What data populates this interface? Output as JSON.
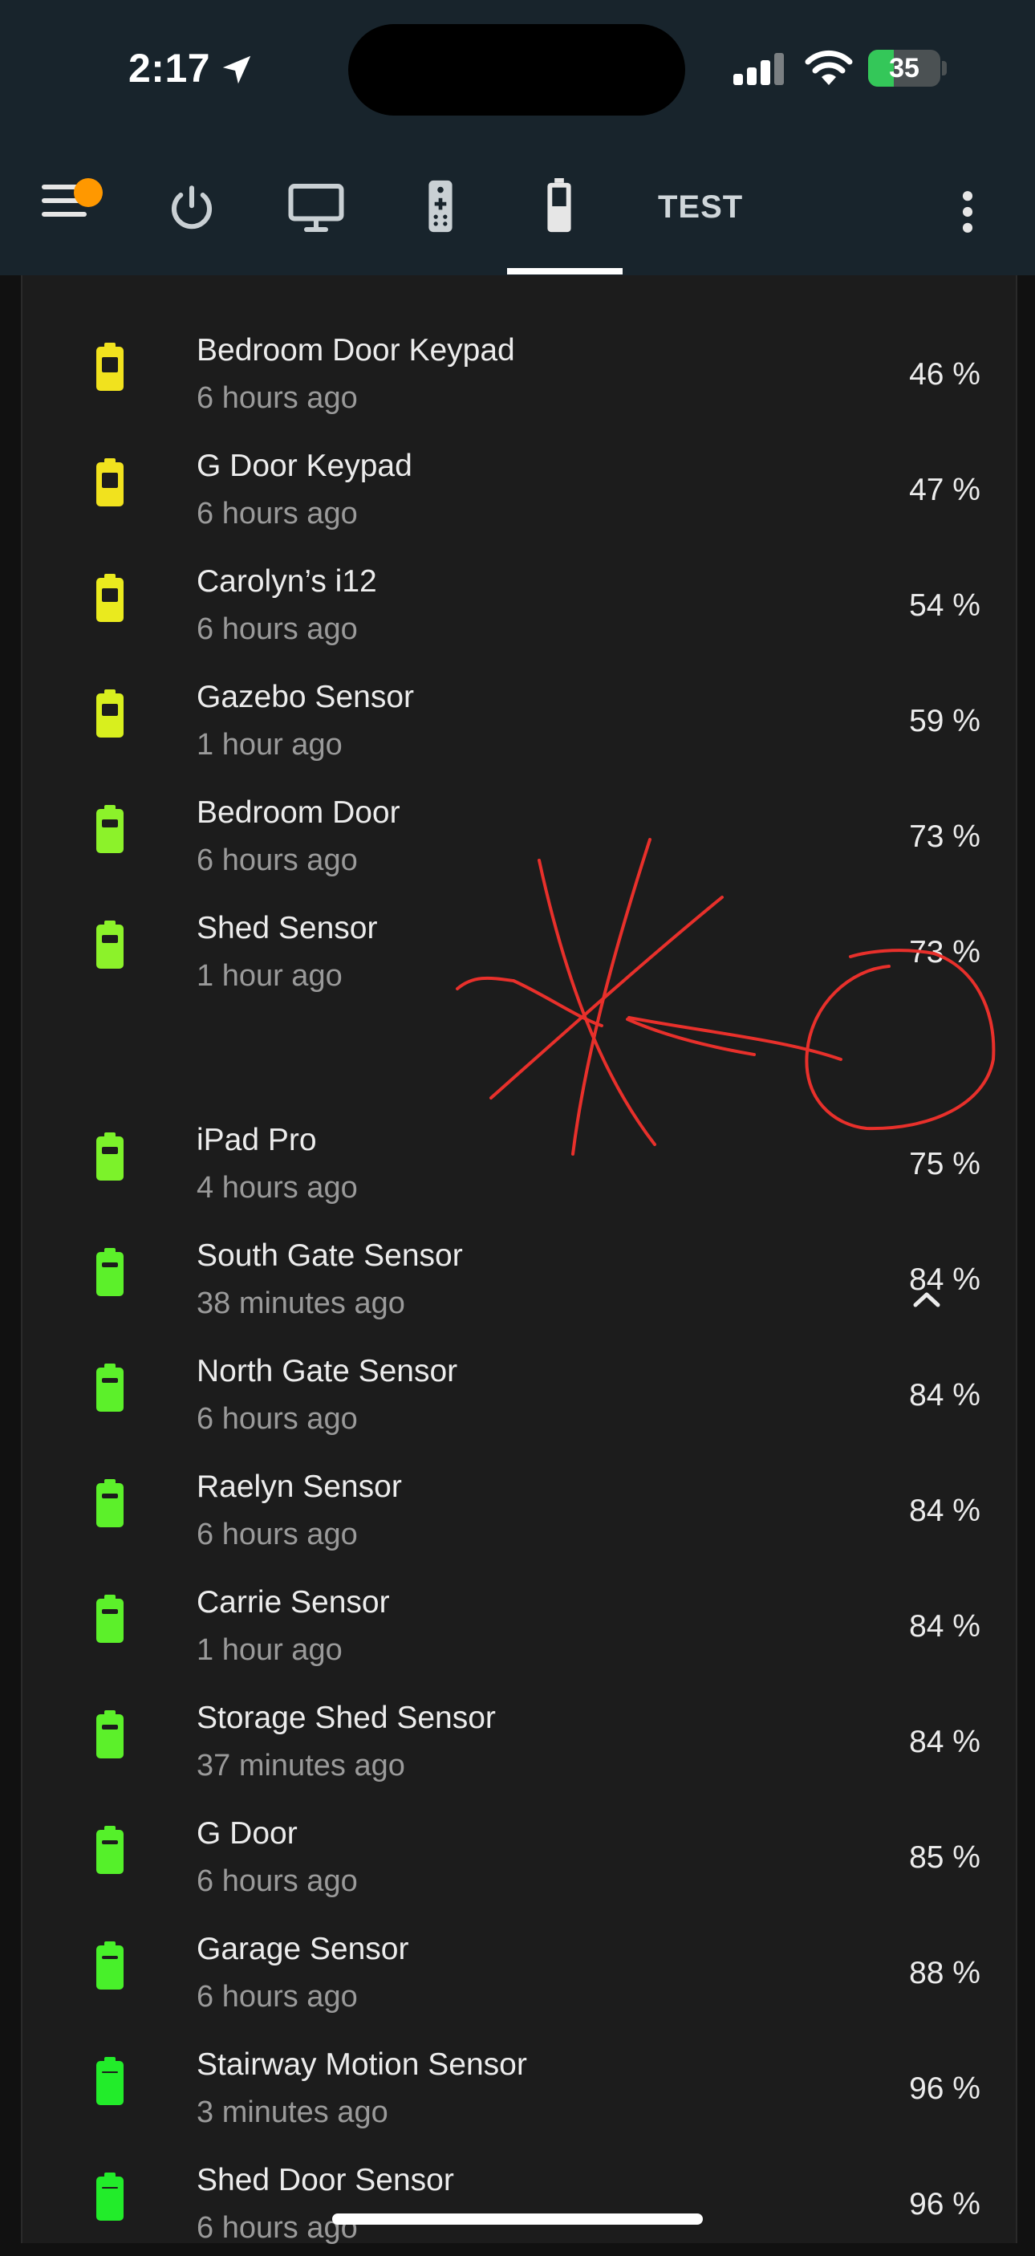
{
  "status_bar": {
    "time": "2:17",
    "battery_percent": "35",
    "battery_level": 0.35,
    "location_icon": "location-arrow-icon",
    "signal_icon": "cellular-signal-icon",
    "wifi_icon": "wifi-icon"
  },
  "toolbar": {
    "menu_icon": "hamburger-menu-icon",
    "notification_dot_color": "#ff9800",
    "tabs": [
      {
        "icon": "power-icon"
      },
      {
        "icon": "monitor-icon"
      },
      {
        "icon": "remote-control-icon"
      },
      {
        "icon": "battery-icon",
        "active": true
      },
      {
        "label": "TEST"
      }
    ],
    "overflow_icon": "more-vertical-icon"
  },
  "devices": [
    {
      "name": "Bedroom Door Keypad",
      "updated": "6 hours ago",
      "level": "46 %",
      "color": "#f1e21e"
    },
    {
      "name": "G Door Keypad",
      "updated": "6 hours ago",
      "level": "47 %",
      "color": "#f1e21e"
    },
    {
      "name": "Carolyn’s i12",
      "updated": "6 hours ago",
      "level": "54 %",
      "color": "#eaea1e"
    },
    {
      "name": "Gazebo Sensor",
      "updated": "1 hour ago",
      "level": "59 %",
      "color": "#d8ef1e"
    },
    {
      "name": "Bedroom Door",
      "updated": "6 hours ago",
      "level": "73 %",
      "color": "#8cf22a"
    },
    {
      "name": "Shed Sensor",
      "updated": "1 hour ago",
      "level": "73 %",
      "color": "#8cf22a"
    },
    {
      "name": "iPad Pro",
      "updated": "4 hours ago",
      "level": "75 %",
      "color": "#7cf22a"
    },
    {
      "name": "South Gate Sensor",
      "updated": "38 minutes ago",
      "level": "84 %",
      "color": "#5cf02a"
    },
    {
      "name": "North Gate Sensor",
      "updated": "6 hours ago",
      "level": "84 %",
      "color": "#5cf02a"
    },
    {
      "name": "Raelyn Sensor",
      "updated": "6 hours ago",
      "level": "84 %",
      "color": "#5cf02a"
    },
    {
      "name": "Carrie Sensor",
      "updated": "1 hour ago",
      "level": "84 %",
      "color": "#5cf02a"
    },
    {
      "name": "Storage Shed Sensor",
      "updated": "37 minutes ago",
      "level": "84 %",
      "color": "#5cf02a"
    },
    {
      "name": "G Door",
      "updated": "6 hours ago",
      "level": "85 %",
      "color": "#55f02a"
    },
    {
      "name": "Garage Sensor",
      "updated": "6 hours ago",
      "level": "88 %",
      "color": "#48f02a"
    },
    {
      "name": "Stairway Motion Sensor",
      "updated": "3 minutes ago",
      "level": "96 %",
      "color": "#22ec2a"
    },
    {
      "name": "Shed Door Sensor",
      "updated": "6 hours ago",
      "level": "96 %",
      "color": "#22ec2a"
    }
  ],
  "collapse": {
    "icon": "chevron-up-icon"
  },
  "annotation": {
    "color": "#e8302b",
    "marks": [
      "red-x-scribble",
      "red-arrow-line",
      "red-circle"
    ]
  }
}
